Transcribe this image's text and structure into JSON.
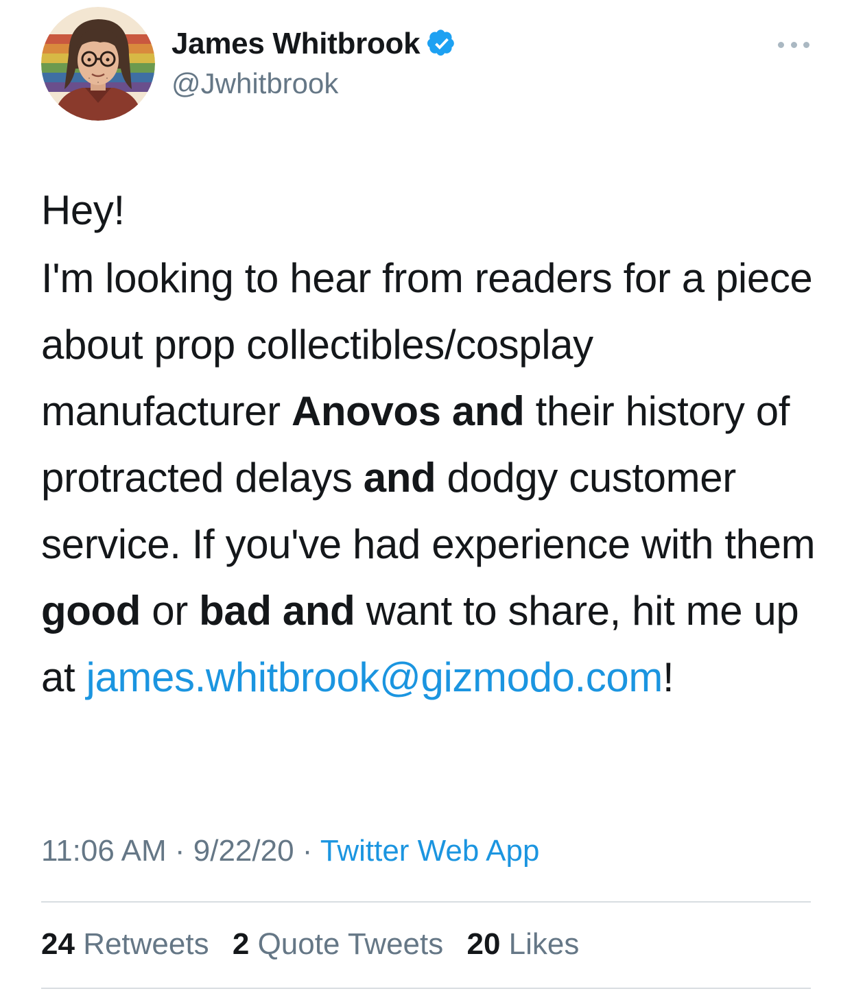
{
  "user": {
    "display_name": "James Whitbrook",
    "handle": "@Jwhitbrook",
    "verified": true
  },
  "tweet": {
    "greeting": "Hey!",
    "body": [
      {
        "t": "I'm looking to hear from readers for a piece about prop collectibles/cosplay manufacturer ",
        "b": false
      },
      {
        "t": "Anovos and",
        "b": true
      },
      {
        "t": " their history of protracted delays ",
        "b": false
      },
      {
        "t": "and",
        "b": true
      },
      {
        "t": " dodgy customer service. If you've had experience with them ",
        "b": false
      },
      {
        "t": "good",
        "b": true
      },
      {
        "t": " or ",
        "b": false
      },
      {
        "t": "bad",
        "b": true
      },
      {
        "t": " ",
        "b": false
      },
      {
        "t": "and",
        "b": true
      },
      {
        "t": " want to share, hit me up at ",
        "b": false
      }
    ],
    "email": "james.whitbrook@gizmodo.com",
    "trailing": "!"
  },
  "meta": {
    "time": "11:06 AM",
    "separator": " · ",
    "date": "9/22/20",
    "source": "Twitter Web App"
  },
  "stats": {
    "retweets_count": "24",
    "retweets_label": "Retweets",
    "quotes_count": "2",
    "quotes_label": "Quote Tweets",
    "likes_count": "20",
    "likes_label": "Likes"
  },
  "colors": {
    "link": "#1b95e0",
    "secondary_text": "#657786",
    "verified_badge": "#1da1f2"
  },
  "icons": {
    "verified": "verified-badge-icon",
    "more": "more-options-icon"
  }
}
